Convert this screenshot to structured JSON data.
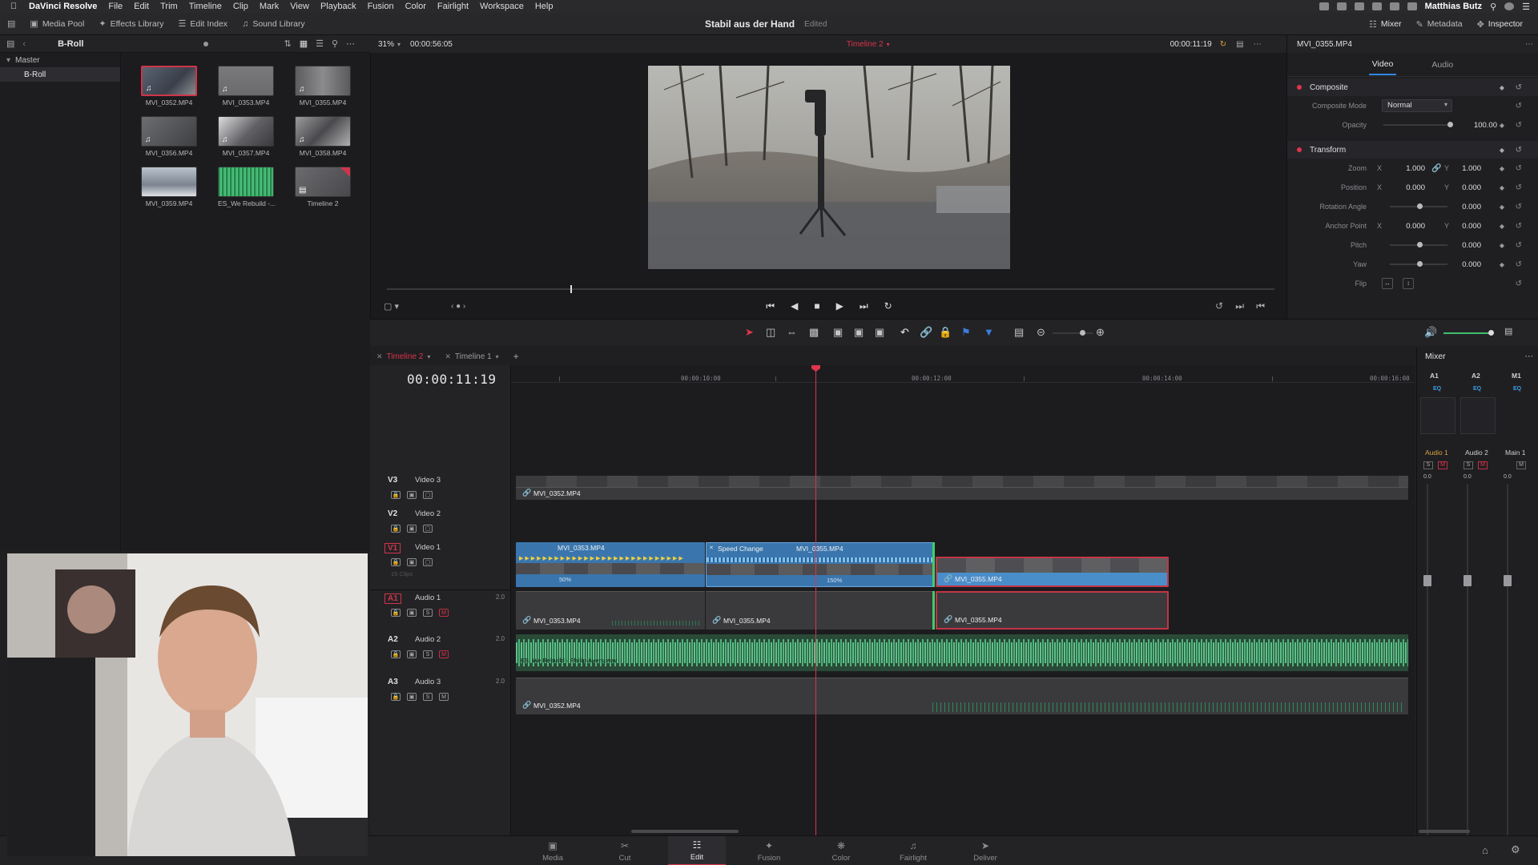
{
  "menubar": {
    "app_name": "DaVinci Resolve",
    "items": [
      "File",
      "Edit",
      "Trim",
      "Timeline",
      "Clip",
      "Mark",
      "View",
      "Playback",
      "Fusion",
      "Color",
      "Fairlight",
      "Workspace",
      "Help"
    ],
    "user": "Matthias Butz"
  },
  "toolbar": {
    "media_pool": "Media Pool",
    "effects_library": "Effects Library",
    "edit_index": "Edit Index",
    "sound_library": "Sound Library",
    "project_name": "Stabil aus der Hand",
    "project_status": "Edited",
    "mixer": "Mixer",
    "metadata": "Metadata",
    "inspector": "Inspector"
  },
  "media_pool": {
    "bin_title": "B-Roll",
    "tree": [
      "Master",
      "B-Roll"
    ],
    "clips": [
      {
        "name": "MVI_0352.MP4",
        "selected": true
      },
      {
        "name": "MVI_0353.MP4"
      },
      {
        "name": "MVI_0355.MP4"
      },
      {
        "name": "MVI_0356.MP4"
      },
      {
        "name": "MVI_0357.MP4"
      },
      {
        "name": "MVI_0358.MP4"
      },
      {
        "name": "MVI_0359.MP4"
      },
      {
        "name": "ES_We Rebuild -..."
      },
      {
        "name": "Timeline 2"
      }
    ]
  },
  "viewer": {
    "zoom": "31%",
    "duration": "00:00:56:05",
    "timeline_name": "Timeline 2",
    "timecode": "00:00:11:19",
    "clip_name": "MVI_0355.MP4"
  },
  "inspector": {
    "tabs": [
      "Video",
      "Audio"
    ],
    "composite": {
      "title": "Composite",
      "mode_label": "Composite Mode",
      "mode_value": "Normal",
      "opacity_label": "Opacity",
      "opacity_value": "100.00"
    },
    "transform": {
      "title": "Transform",
      "zoom_label": "Zoom",
      "zoom_x": "1.000",
      "zoom_y": "1.000",
      "position_label": "Position",
      "position_x": "0.000",
      "position_y": "0.000",
      "rotation_label": "Rotation Angle",
      "rotation_value": "0.000",
      "anchor_label": "Anchor Point",
      "anchor_x": "0.000",
      "anchor_y": "0.000",
      "pitch_label": "Pitch",
      "pitch_value": "0.000",
      "yaw_label": "Yaw",
      "yaw_value": "0.000",
      "flip_label": "Flip",
      "x": "X",
      "y": "Y"
    }
  },
  "timeline": {
    "tabs": [
      "Timeline 2",
      "Timeline 1"
    ],
    "timecode": "00:00:11:19",
    "ruler": [
      "00:00:10:00",
      "00:00:12:00",
      "00:00:14:00",
      "00:00:16:00"
    ],
    "tracks": [
      {
        "code": "V3",
        "name": "Video 3"
      },
      {
        "code": "V2",
        "name": "Video 2"
      },
      {
        "code": "V1",
        "name": "Video 1",
        "sub": "15 Clips"
      },
      {
        "code": "A1",
        "name": "Audio 1",
        "level": "2.0"
      },
      {
        "code": "A2",
        "name": "Audio 2",
        "level": "2.0"
      },
      {
        "code": "A3",
        "name": "Audio 3",
        "level": "2.0"
      }
    ],
    "clips": {
      "v3": "MVI_0352.MP4",
      "v1_a": "MVI_0353.MP4",
      "v1_b_effect": "Speed Change",
      "v1_b": "MVI_0355.MP4",
      "v1_c": "MVI_0355.MP4",
      "v1_a_speed": "50%",
      "v1_b_speed": "150%",
      "a1_a": "MVI_0353.MP4",
      "a1_b": "MVI_0355.MP4",
      "a1_c": "MVI_0355.MP4",
      "a2": "ES_We Rebuild - Philip Ayers.wav",
      "a3": "MVI_0352.MP4"
    }
  },
  "mixer": {
    "title": "Mixer",
    "channels": [
      "A1",
      "A2",
      "M1"
    ],
    "eq": "EQ",
    "names": [
      "Audio 1",
      "Audio 2",
      "Main 1"
    ],
    "levels": [
      "0.0",
      "0.0",
      "0.0"
    ]
  },
  "pages": [
    "Media",
    "Cut",
    "Edit",
    "Fusion",
    "Color",
    "Fairlight",
    "Deliver"
  ],
  "colors": {
    "accent_red": "#d8344a",
    "clip_blue": "#4a8ec9",
    "audio_green": "#5ec38b",
    "selection_blue": "#2f88e0"
  }
}
